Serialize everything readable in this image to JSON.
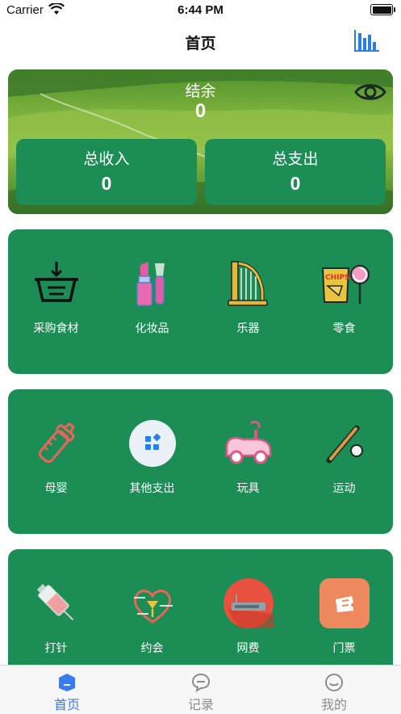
{
  "status_bar": {
    "carrier": "Carrier",
    "time": "6:44 PM"
  },
  "nav": {
    "title": "首页",
    "chart_icon": "bar-chart-icon"
  },
  "balance": {
    "label": "结余",
    "value": "0",
    "income_label": "总收入",
    "income_value": "0",
    "expense_label": "总支出",
    "expense_value": "0",
    "eye_icon": "eye-icon"
  },
  "categories": [
    [
      {
        "label": "采购食材",
        "icon": "basket-icon"
      },
      {
        "label": "化妆品",
        "icon": "lipstick-icon"
      },
      {
        "label": "乐器",
        "icon": "harp-icon"
      },
      {
        "label": "零食",
        "icon": "snacks-icon"
      }
    ],
    [
      {
        "label": "母婴",
        "icon": "baby-bottle-icon"
      },
      {
        "label": "其他支出",
        "icon": "other-icon"
      },
      {
        "label": "玩具",
        "icon": "toy-car-icon"
      },
      {
        "label": "运动",
        "icon": "baseball-icon"
      }
    ],
    [
      {
        "label": "打针",
        "icon": "syringe-icon"
      },
      {
        "label": "约会",
        "icon": "date-icon"
      },
      {
        "label": "网费",
        "icon": "router-icon"
      },
      {
        "label": "门票",
        "icon": "ticket-icon"
      }
    ]
  ],
  "tabs": [
    {
      "label": "首页",
      "icon": "home-icon",
      "active": true
    },
    {
      "label": "记录",
      "icon": "chat-icon",
      "active": false
    },
    {
      "label": "我的",
      "icon": "profile-icon",
      "active": false
    }
  ],
  "colors": {
    "primary_green": "#1c8d55",
    "tab_active": "#3a7bf2",
    "tab_inactive": "#8c8c8c"
  }
}
